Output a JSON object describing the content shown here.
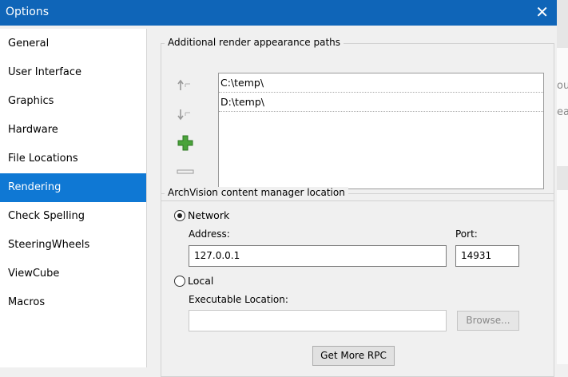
{
  "window": {
    "title": "Options",
    "close_glyph": "✕"
  },
  "background": {
    "text1": "ou",
    "text2": "ea"
  },
  "sidebar": {
    "items": [
      {
        "label": "General"
      },
      {
        "label": "User Interface"
      },
      {
        "label": "Graphics"
      },
      {
        "label": "Hardware"
      },
      {
        "label": "File Locations"
      },
      {
        "label": "Rendering"
      },
      {
        "label": "Check Spelling"
      },
      {
        "label": "SteeringWheels"
      },
      {
        "label": "ViewCube"
      },
      {
        "label": "Macros"
      }
    ],
    "active": "Rendering"
  },
  "render_paths": {
    "legend": "Additional render appearance paths",
    "paths": [
      "C:\\temp\\",
      "D:\\temp\\"
    ],
    "icons": [
      "move-up-icon",
      "move-down-icon",
      "add-icon",
      "remove-icon"
    ]
  },
  "archvision": {
    "legend": "ArchVision content manager location",
    "network_label": "Network",
    "network_selected": true,
    "address_label": "Address:",
    "address_value": "127.0.0.1",
    "port_label": "Port:",
    "port_value": "14931",
    "local_label": "Local",
    "local_selected": false,
    "exe_label": "Executable Location:",
    "exe_value": "",
    "browse_label": "Browse...",
    "get_rpc_label": "Get More RPC"
  },
  "colors": {
    "titlebar": "#0f65b8",
    "selection": "#0f78d4",
    "add_icon": "#4aa33a"
  }
}
